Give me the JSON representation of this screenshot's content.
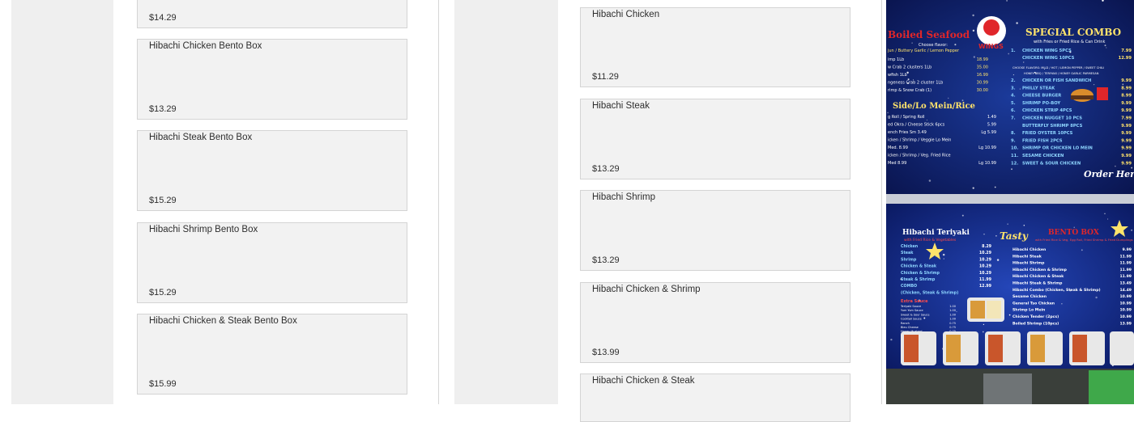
{
  "left_column": {
    "items": [
      {
        "name": "",
        "price": "$14.29"
      },
      {
        "name": "Hibachi Chicken Bento Box",
        "price": "$13.29"
      },
      {
        "name": "Hibachi Steak Bento Box",
        "price": "$15.29"
      },
      {
        "name": "Hibachi Shrimp Bento Box",
        "price": "$15.29"
      },
      {
        "name": "Hibachi Chicken & Steak Bento Box",
        "price": "$15.99"
      }
    ]
  },
  "right_column": {
    "items": [
      {
        "name": "Hibachi Chicken",
        "price": "$11.29"
      },
      {
        "name": "Hibachi Steak",
        "price": "$13.29"
      },
      {
        "name": "Hibachi Shrimp",
        "price": "$13.29"
      },
      {
        "name": "Hibachi Chicken & Shrimp",
        "price": "$13.99"
      },
      {
        "name": "Hibachi Chicken & Steak",
        "price": ""
      }
    ]
  },
  "menu_photo": {
    "top_board": {
      "left_title": "Boiled Seafood",
      "left_flavor": "Choose flavor:",
      "left_flavor_options": "jun / Buttery Garlic / Lemon Pepper",
      "left_items": [
        {
          "name": "imp 1Lb",
          "price": "18.99"
        },
        {
          "name": "w Crab 2 clusters 1Lb",
          "price": "35.00"
        },
        {
          "name": "wfish 1Lb",
          "price": "16.99"
        },
        {
          "name": "ngeness Crab 2 cluster 1Lb",
          "price": "30.99"
        },
        {
          "name": "rimp & Snow Crab (1)",
          "price": "30.00"
        }
      ],
      "side_title": "Side/Lo Mein/Rice",
      "side_items": [
        {
          "name": "g Roll / Spring Roll",
          "price": "1.49"
        },
        {
          "name": "ed Okra / Cheese Stick 6pcs",
          "price": "5.99"
        },
        {
          "name": "ench Fries   Sm 3.49",
          "price": "Lg 5.99"
        },
        {
          "name": "icken / Shrimp / Veggie Lo Mein",
          "price": ""
        },
        {
          "name": "Med. 8.99",
          "price": "Lg 10.99"
        },
        {
          "name": "icken / Shrimp / Veg. Fried Rice",
          "price": ""
        },
        {
          "name": "Med 8.99",
          "price": "Lg 10.99"
        }
      ],
      "logo_text": "WINGS",
      "right_title": "SPECIAL COMBO",
      "right_subtitle": "with Fries or Fried Rice & Can Drink",
      "right_flavors": "CHOOSE FLAVORS:  MILD / HOT / LEMON PEPPER / SWEET CHILI",
      "right_flavors_2": "HONEY BBQ / TERIYAKI / HONEY GARLIC PARMESAN",
      "combo_items": [
        {
          "num": "1.",
          "name": "CHICKEN WING 5PCS",
          "price": "7.99"
        },
        {
          "num": "",
          "name": "CHICKEN WING 10PCS",
          "price": "12.99"
        },
        {
          "num": "2.",
          "name": "CHICKEN OR FISH SANDWICH",
          "price": "9.99"
        },
        {
          "num": "3.",
          "name": "PHILLY STEAK",
          "price": "8.99"
        },
        {
          "num": "4.",
          "name": "CHEESE BURGER",
          "price": "8.99"
        },
        {
          "num": "5.",
          "name": "SHRIMP PO-BOY",
          "price": "9.99"
        },
        {
          "num": "6.",
          "name": "CHICKEN STRIP 4PCS",
          "price": "9.99"
        },
        {
          "num": "7.",
          "name": "CHICKEN NUGGET 10 PCS",
          "price": "7.99"
        },
        {
          "num": "",
          "name": "BUTTERFLY SHRIMP 8PCS",
          "price": "9.99"
        },
        {
          "num": "8.",
          "name": "FRIED OYSTER 10PCS",
          "price": "9.99"
        },
        {
          "num": "9.",
          "name": "FRIED FISH 2PCS",
          "price": "9.99"
        },
        {
          "num": "10.",
          "name": "SHRIMP OR CHICKEN LO MEIN",
          "price": "9.99"
        },
        {
          "num": "11.",
          "name": "SESAME CHICKEN",
          "price": "9.99"
        },
        {
          "num": "12.",
          "name": "SWEET & SOUR CHICKEN",
          "price": "9.99"
        }
      ],
      "order_here": "Order Here"
    },
    "bottom_board": {
      "left_title": "Hibachi Teriyaki",
      "left_subtitle": "with Fried Rice & Vegetables",
      "left_items": [
        {
          "name": "Chicken",
          "price": "8.29"
        },
        {
          "name": "Steak",
          "price": "10.29"
        },
        {
          "name": "Shrimp",
          "price": "10.29"
        },
        {
          "name": "Chicken & Steak",
          "price": "10.29"
        },
        {
          "name": "Chicken & Shrimp",
          "price": "10.29"
        },
        {
          "name": "Steak & Shrimp",
          "price": "11.99"
        },
        {
          "name": "COMBO",
          "price": "12.99"
        },
        {
          "name": "(Chicken, Steak & Shrimp)",
          "price": ""
        }
      ],
      "extra_sauce_title": "Extra Sauce",
      "extra_sauce": [
        {
          "name": "Teriyaki Sauce",
          "price": "1.00"
        },
        {
          "name": "Yum Yum Sauce",
          "price": "1.00"
        },
        {
          "name": "Sweet & Sour Sauce",
          "price": "1.00"
        },
        {
          "name": "Cocktail Sauce",
          "price": "1.00"
        },
        {
          "name": "Ranch",
          "price": "0.75"
        },
        {
          "name": "Bleu Cheese",
          "price": "0.75"
        },
        {
          "name": "Honey Mustard",
          "price": "0.75"
        },
        {
          "name": "Tartar Sauce",
          "price": "0.75"
        }
      ],
      "center_logo": "Tasty",
      "right_title": "BENTO BOX",
      "right_subtitle": "with Fried Rice & Veg, Egg Roll, Fried Shrimp & Fried Dumplings",
      "right_items": [
        {
          "name": "Hibachi Chicken",
          "price": "9.99"
        },
        {
          "name": "Hibachi Steak",
          "price": "11.99"
        },
        {
          "name": "Hibachi Shrimp",
          "price": "11.99"
        },
        {
          "name": "Hibachi Chicken & Shrimp",
          "price": "11.99"
        },
        {
          "name": "Hibachi Chicken & Steak",
          "price": "11.99"
        },
        {
          "name": "Hibachi Steak & Shrimp",
          "price": "13.49"
        },
        {
          "name": "Hibachi Combo (Chicken, Steak & Shrimp)",
          "price": "14.49"
        },
        {
          "name": "Sesame Chicken",
          "price": "10.99"
        },
        {
          "name": "General Tso Chicken",
          "price": "10.99"
        },
        {
          "name": "Shrimp Lo Mein",
          "price": "10.99"
        },
        {
          "name": "Chicken Tender (2pcs)",
          "price": "10.99"
        },
        {
          "name": "Boiled Shrimp (10pcs)",
          "price": "13.99"
        }
      ]
    },
    "colors": {
      "board_bg": "#0b1a5c",
      "title_red": "#e0262a",
      "title_yellow": "#ffe36b",
      "text_white": "#ffffff",
      "frame_grey": "#2a2c33"
    }
  }
}
